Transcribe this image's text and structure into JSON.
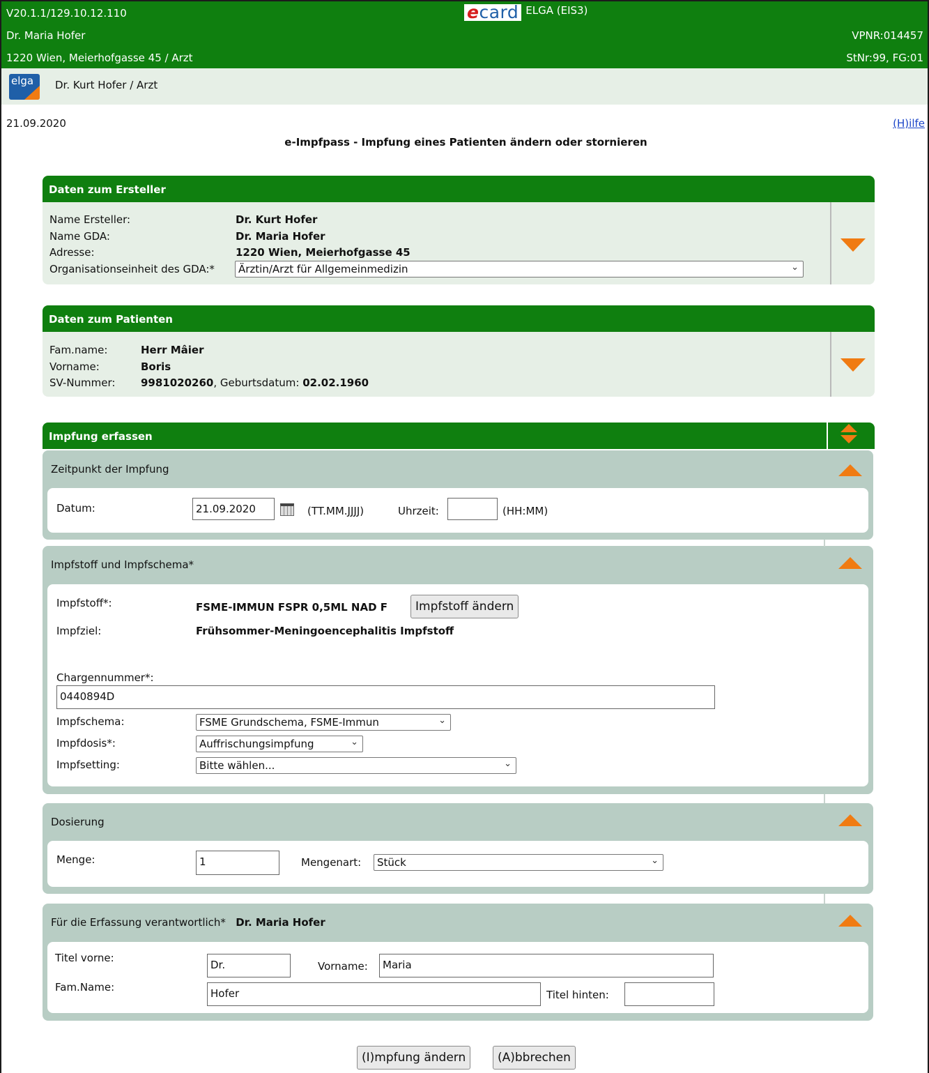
{
  "header": {
    "version_ip": "V20.1.1/129.10.12.110",
    "ecard_brand": "ecard",
    "app_title": "ELGA (EIS3)",
    "gda_name": "Dr. Maria Hofer",
    "vpnr": "VPNR:014457",
    "address": "1220 Wien, Meierhofgasse 45 / Arzt",
    "stnr": "StNr:99, FG:01",
    "elga_logo": "elga",
    "user": "Dr. Kurt Hofer / Arzt"
  },
  "date": "21.09.2020",
  "help_link": "(H)ilfe",
  "page_title": "e-Impfpass - Impfung eines Patienten ändern oder stornieren",
  "ersteller": {
    "title": "Daten zum Ersteller",
    "name_label": "Name Ersteller:",
    "name_value": "Dr. Kurt Hofer",
    "gda_label": "Name GDA:",
    "gda_value": "Dr. Maria Hofer",
    "addr_label": "Adresse:",
    "addr_value": "1220 Wien, Meierhofgasse 45",
    "org_label": "Organisationseinheit des GDA:*",
    "org_value": "Ärztin/Arzt für Allgemeinmedizin"
  },
  "patient": {
    "title": "Daten zum Patienten",
    "famname_label": "Fam.name:",
    "famname_value": "Herr Mâier",
    "vorname_label": "Vorname:",
    "vorname_value": "Boris",
    "sv_label": "SV-Nummer:",
    "sv_value": "9981020260",
    "geb_label": ", Geburtsdatum:",
    "geb_value": "02.02.1960"
  },
  "impfung": {
    "title": "Impfung erfassen",
    "zeitpunkt": {
      "title": "Zeitpunkt der Impfung",
      "datum_label": "Datum:",
      "datum_value": "21.09.2020",
      "datum_format": "(TT.MM.JJJJ)",
      "uhrzeit_label": "Uhrzeit:",
      "uhrzeit_value": "",
      "uhrzeit_format": "(HH:MM)"
    },
    "impfstoff": {
      "title": "Impfstoff und Impfschema*",
      "impfstoff_label": "Impfstoff*:",
      "impfstoff_value": "FSME-IMMUN FSPR 0,5ML NAD F",
      "impfstoff_button": "Impfstoff ändern",
      "impfziel_label": "Impfziel:",
      "impfziel_value": "Frühsommer-Meningoencephalitis Impfstoff",
      "charge_label": "Chargennummer*:",
      "charge_value": "0440894D",
      "schema_label": "Impfschema:",
      "schema_value": "FSME Grundschema, FSME-Immun",
      "dosis_label": "Impfdosis*:",
      "dosis_value": "Auffrischungsimpfung",
      "setting_label": "Impfsetting:",
      "setting_value": "Bitte wählen..."
    },
    "dosierung": {
      "title": "Dosierung",
      "menge_label": "Menge:",
      "menge_value": "1",
      "mengenart_label": "Mengenart:",
      "mengenart_value": "Stück"
    },
    "verantwortlich": {
      "title": "Für die Erfassung verantwortlich*",
      "name": "Dr. Maria Hofer",
      "titel_vorne_label": "Titel vorne:",
      "titel_vorne_value": "Dr.",
      "vorname_label": "Vorname:",
      "vorname_value": "Maria",
      "famname_label": "Fam.Name:",
      "famname_value": "Hofer",
      "titel_hinten_label": "Titel hinten:",
      "titel_hinten_value": ""
    }
  },
  "actions": {
    "save": "(I)mpfung ändern",
    "cancel": "(A)bbrechen"
  },
  "colors": {
    "header_green": "#0f7f0f",
    "panel_light": "#e6efe6",
    "section_gray": "#b8cdc4",
    "accent_orange": "#f07b12",
    "link_blue": "#1a44c8"
  }
}
